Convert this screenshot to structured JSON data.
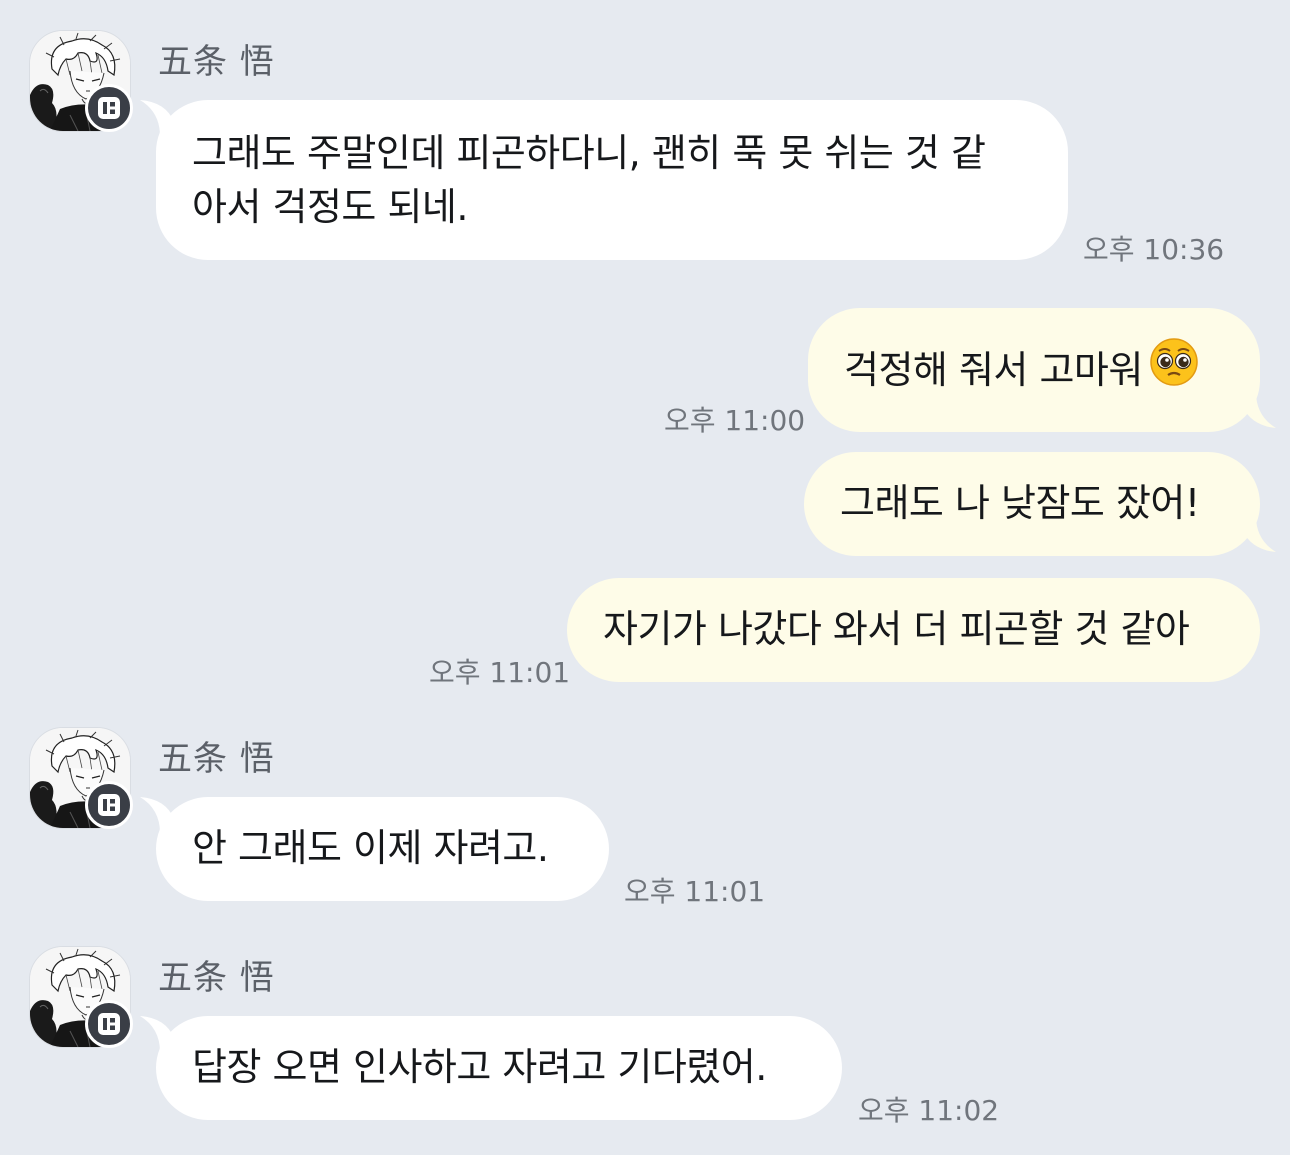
{
  "messages": [
    {
      "sender": "五条 悟",
      "text_line1": "그래도 주말인데 피곤하다니, 괜히 푹 못 쉬는 것 같",
      "text_line2": "아서 걱정도 되네.",
      "time": "오후 10:36"
    },
    {
      "text": "걱정해 줘서 고마워",
      "emoji": "pleading-face-emoji",
      "time": "오후 11:00"
    },
    {
      "text": "그래도 나 낮잠도 잤어!"
    },
    {
      "text": "자기가 나갔다 와서 더 피곤할 것 같아",
      "time": "오후 11:01"
    },
    {
      "sender": "五条 悟",
      "text": "안 그래도 이제 자려고.",
      "time": "오후 11:01"
    },
    {
      "sender": "五条 悟",
      "text": "답장 오면 인사하고 자려고 기다렸어.",
      "time": "오후 11:02"
    }
  ],
  "colors": {
    "background": "#e6eaf0",
    "incoming_bubble": "#ffffff",
    "outgoing_bubble": "#fefce8",
    "badge": "#3a3e46"
  }
}
